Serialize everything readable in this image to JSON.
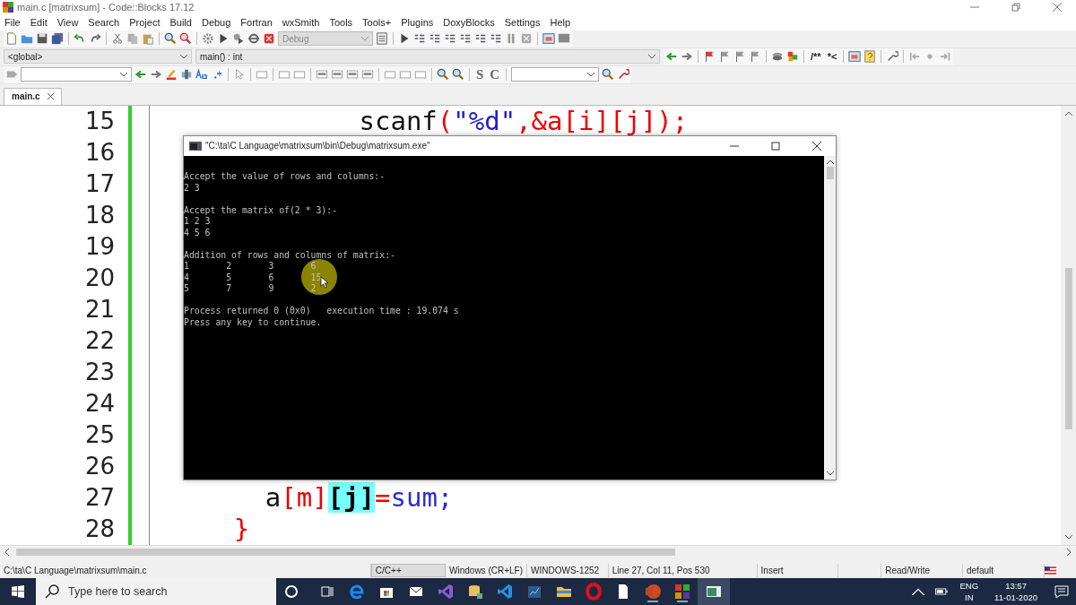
{
  "window": {
    "title": "main.c [matrixsum] - Code::Blocks 17.12"
  },
  "menu": [
    "File",
    "Edit",
    "View",
    "Search",
    "Project",
    "Build",
    "Debug",
    "Fortran",
    "wxSmith",
    "Tools",
    "Tools+",
    "Plugins",
    "DoxyBlocks",
    "Settings",
    "Help"
  ],
  "toolbar": {
    "build_target": "Debug",
    "scope": "<global>",
    "function": "main() : int",
    "doxy_block": "/**",
    "doxy_line": "*<",
    "strike_s": "S",
    "strike_c": "C"
  },
  "tabs": [
    {
      "label": "main.c",
      "selected": true
    }
  ],
  "editor": {
    "lines": [
      {
        "number": "15",
        "tokens": [
          {
            "kind": "plain",
            "text": "            scanf"
          },
          {
            "kind": "op",
            "text": "("
          },
          {
            "kind": "str",
            "text": "\"%d\""
          },
          {
            "kind": "op",
            "text": ",&a[i][j]);"
          }
        ]
      },
      {
        "number": "16"
      },
      {
        "number": "17"
      },
      {
        "number": "18"
      },
      {
        "number": "19"
      },
      {
        "number": "20"
      },
      {
        "number": "21"
      },
      {
        "number": "22"
      },
      {
        "number": "23"
      },
      {
        "number": "24"
      },
      {
        "number": "25"
      },
      {
        "number": "26"
      },
      {
        "number": "27",
        "tokens": [
          {
            "kind": "plain",
            "text": "      a"
          },
          {
            "kind": "op",
            "text": "[m]"
          },
          {
            "kind": "match",
            "text": "[j]"
          },
          {
            "kind": "op",
            "text": "="
          },
          {
            "kind": "ident",
            "text": "sum;"
          }
        ]
      },
      {
        "number": "28",
        "tokens": [
          {
            "kind": "op",
            "text": "    }"
          }
        ]
      }
    ]
  },
  "console": {
    "title": "\"C:\\ta\\C Language\\matrixsum\\bin\\Debug\\matrixsum.exe\"",
    "blocks": [
      [
        "Accept the value of rows and columns:-",
        "2 3"
      ],
      [
        "Accept the matrix of(2 * 3):-",
        "1 2 3",
        "4 5 6"
      ],
      [
        "Addition of rows and columns of matrix:-",
        "1\t2\t3\t6",
        "4\t5\t6\t15",
        "5\t7\t9\t2"
      ],
      [
        "Process returned 0 (0x0)   execution time : 19.074 s",
        "Press any key to continue."
      ]
    ]
  },
  "status_bar": [
    {
      "kind": "path",
      "text": "C:\\ta\\C Language\\matrixsum\\main.c"
    },
    {
      "kind": "lang",
      "text": "C/C++"
    },
    {
      "kind": "field",
      "text": "Windows (CR+LF)"
    },
    {
      "kind": "field",
      "text": "WINDOWS-1252"
    },
    {
      "kind": "wide",
      "text": "Line 27, Col 11, Pos 530"
    },
    {
      "kind": "field",
      "text": "Insert"
    },
    {
      "kind": "blank"
    },
    {
      "kind": "field",
      "text": "Read/Write"
    },
    {
      "kind": "field",
      "text": "default"
    }
  ],
  "taskbar": {
    "search_placeholder": "Type here to search",
    "language": "ENG",
    "region": "IN",
    "time": "13:57",
    "date": "11-01-2020"
  }
}
